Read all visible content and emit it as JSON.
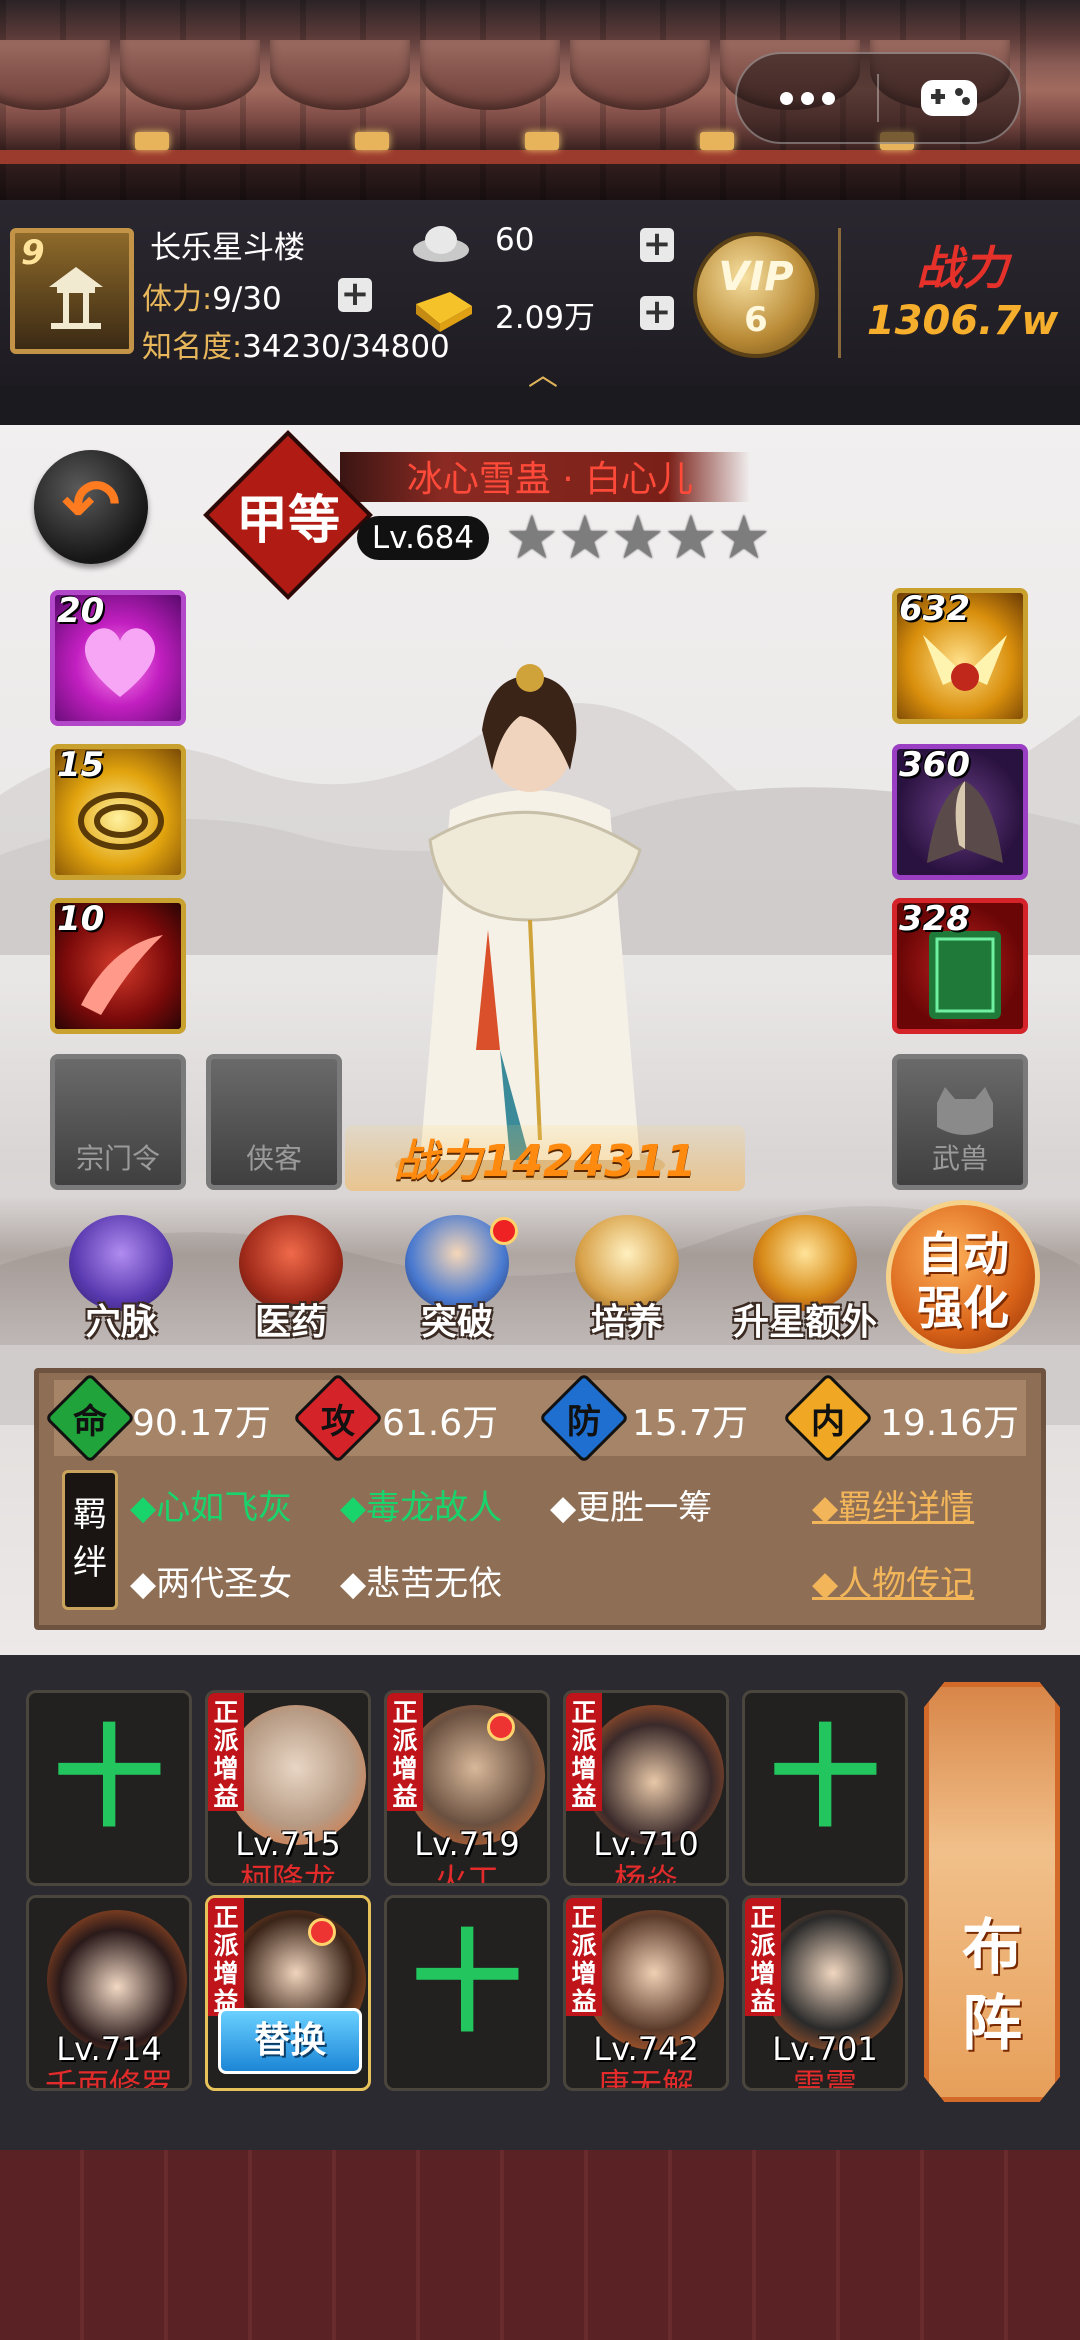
{
  "colors": {
    "accent_gold": "#e8b75b",
    "name_red": "#ff4a3a",
    "bond_green": "#19d36b",
    "power_orange": "#ff8a10"
  },
  "hud": {
    "player_level": "9",
    "player_name": "长乐星斗楼",
    "stamina_label": "体力:",
    "stamina_value": "9/30",
    "fame_label": "知名度:",
    "fame_value": "34230/34800",
    "silver_value": "60",
    "gold_value": "2.09万",
    "vip_label": "VIP",
    "vip_level": "6",
    "power_label": "战力",
    "power_value": "1306.7w"
  },
  "hero": {
    "grade": "甲等",
    "name": "冰心雪蛊 · 白心儿",
    "level": "Lv.684",
    "stars": [
      "★",
      "★",
      "★",
      "★",
      "★"
    ],
    "power_label": "战力",
    "power_value": "1424311"
  },
  "skills_left": [
    {
      "num": "20",
      "icon": "heart-skill-icon"
    },
    {
      "num": "15",
      "icon": "vortex-skill-icon"
    },
    {
      "num": "10",
      "icon": "red-slash-skill-icon"
    }
  ],
  "equip_right": [
    {
      "num": "632",
      "icon": "golden-wing-icon"
    },
    {
      "num": "360",
      "icon": "cloak-icon"
    },
    {
      "num": "328",
      "icon": "green-book-icon"
    }
  ],
  "empty_slots": [
    "宗门令",
    "侠客",
    "武兽"
  ],
  "functions": [
    {
      "label": "穴脉"
    },
    {
      "label": "医药"
    },
    {
      "label": "突破"
    },
    {
      "label": "培养"
    },
    {
      "label": "升星额外"
    }
  ],
  "auto_enhance": {
    "line1": "自动",
    "line2": "强化"
  },
  "stats": [
    {
      "icon_text": "命",
      "value": "90.17万",
      "color": "#1fa33a"
    },
    {
      "icon_text": "攻",
      "value": "61.6万",
      "color": "#d4242a"
    },
    {
      "icon_text": "防",
      "value": "15.7万",
      "color": "#1f6fd0"
    },
    {
      "icon_text": "内",
      "value": "19.16万",
      "color": "#f0a824"
    }
  ],
  "bonds": {
    "badge": "羁绊",
    "row1": [
      "◆心如飞灰",
      "◆毒龙故人",
      "◆更胜一筹"
    ],
    "row2": [
      "◆两代圣女",
      "◆悲苦无依"
    ],
    "detail_link": "◆羁绊详情",
    "biography_link": "◆人物传记"
  },
  "team": {
    "tag": "正派增益",
    "row1": [
      {
        "empty": true
      },
      {
        "level": "Lv.715",
        "name": "柯降龙"
      },
      {
        "level": "Lv.719",
        "name": "火工"
      },
      {
        "level": "Lv.710",
        "name": "杨焱"
      },
      {
        "empty": true
      }
    ],
    "row2": [
      {
        "level": "Lv.714",
        "name": "千面修罗"
      },
      {
        "replace_label": "替换"
      },
      {
        "empty": true
      },
      {
        "level": "Lv.742",
        "name": "唐无解"
      },
      {
        "level": "Lv.701",
        "name": "雷震"
      }
    ],
    "formation_label": "布阵"
  }
}
